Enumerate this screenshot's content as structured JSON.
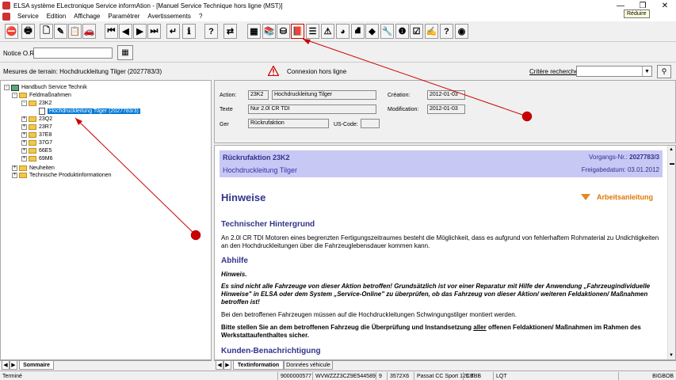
{
  "window": {
    "title": "ELSA système ELectronique Service informAtion - [Manuel Service Technique hors ligne (MST)]",
    "minimize_glyph": "—",
    "maximize_glyph": "❐",
    "close_glyph": "✕",
    "tooltip": "Réduire"
  },
  "menu": [
    "Service",
    "Edition",
    "Affichage",
    "Paramétrer",
    "Avertissements",
    "?"
  ],
  "toolbar": {
    "buttons": [
      {
        "name": "exit-icon",
        "glyph": "⛔"
      },
      {
        "name": "print-icon",
        "glyph": "🖶"
      },
      {
        "name": "new-doc-icon",
        "glyph": "🗋"
      },
      {
        "name": "edit-doc-icon",
        "glyph": "✎"
      },
      {
        "name": "clipboard-icon",
        "glyph": "📋"
      },
      {
        "name": "car-icon",
        "glyph": "🚗"
      },
      {
        "name": "first-icon",
        "glyph": "⏮"
      },
      {
        "name": "prev-icon",
        "glyph": "◀"
      },
      {
        "name": "next-icon",
        "glyph": "▶"
      },
      {
        "name": "last-icon",
        "glyph": "⏭"
      },
      {
        "name": "return-icon",
        "glyph": "↵"
      },
      {
        "name": "info-icon",
        "glyph": "ℹ"
      },
      {
        "name": "help-icon",
        "glyph": "?"
      },
      {
        "name": "swap-icon",
        "glyph": "⇄"
      },
      {
        "name": "calculator-icon",
        "glyph": "▦"
      },
      {
        "name": "book-stack-icon",
        "glyph": "📚"
      },
      {
        "name": "cylinder-icon",
        "glyph": "⛁"
      },
      {
        "name": "red-book-icon",
        "glyph": "📕"
      },
      {
        "name": "list-icon",
        "glyph": "☰"
      },
      {
        "name": "warning-icon",
        "glyph": "⚠"
      },
      {
        "name": "globe-icon",
        "glyph": "◕"
      },
      {
        "name": "bucket-icon",
        "glyph": "⛘"
      },
      {
        "name": "green-car-icon",
        "glyph": "◆"
      },
      {
        "name": "wrench-icon",
        "glyph": "🔧"
      },
      {
        "name": "service-icon",
        "glyph": "❶"
      },
      {
        "name": "checklist-icon",
        "glyph": "☑"
      },
      {
        "name": "notes-icon",
        "glyph": "✍"
      },
      {
        "name": "help-doc-icon",
        "glyph": "?"
      },
      {
        "name": "disc-icon",
        "glyph": "◉"
      }
    ]
  },
  "notice": {
    "label": "Notice O.R.:"
  },
  "status": {
    "mesures": "Mesures de terrain: Hochdruckleitung Tilger (2027783/3)",
    "connexion": "Connexion hors ligne",
    "critere": "Critère recherche"
  },
  "tree": {
    "root": "Handbuch Service Technik",
    "feld": "Feldmaßnahmen",
    "k2": "23K2",
    "selected": "Hochdruckleitung Tilger (2027783/3)",
    "children": [
      "23Q2",
      "23R7",
      "37E8",
      "37G7",
      "66E5",
      "69M6"
    ],
    "neuheiten": "Neuheiten",
    "technische": "Technische Produktinformationen",
    "toggle_minus": "-",
    "toggle_plus": "+"
  },
  "left_tabs": {
    "sommaire": "Sommaire"
  },
  "form": {
    "action_label": "Action:",
    "action_code": "23K2",
    "action_text": "Hochdruckleitung Tilger",
    "texte_label": "Texte",
    "texte_value": "Nur 2.0l CR TDI",
    "ger_label": "Ger",
    "ger_value": "Rückrufaktion",
    "uscode_label": "US-Code:",
    "creation_label": "Création:",
    "creation_value": "2012-01-03",
    "modification_label": "Modification:",
    "modification_value": "2012-01-03"
  },
  "content": {
    "header_code": "Rückrufaktion 23K2",
    "header_sub": "Hochdruckleitung Tilger",
    "vorgang_label": "Vorgangs-Nr.:",
    "vorgang_value": "2027783/3",
    "freigabe": "Freigabedatum: 03.01.2012",
    "hinweise": "Hinweise",
    "arbeitsanleitung": "Arbeitsanleitung",
    "sec1": "Technischer Hintergrund",
    "p1": "An 2.0l CR TDI Motoren eines begrenzten Fertigungszeitraumes besteht die Möglichkeit, dass es aufgrund von fehlerhaftem Rohmaterial zu Undichtigkeiten an den Hochdruckleitungen über die Fahrzeuglebensdauer kommen kann.",
    "sec2": "Abhilfe",
    "p2": "Hinweis.",
    "p3": "Es sind nicht alle Fahrzeuge von dieser Aktion betroffen! Grundsätzlich ist vor einer Reparatur mit Hilfe der Anwendung „Fahrzeugindividuelle Hinweise\" in ELSA oder dem System „Service-Online\" zu überprüfen, ob das Fahrzeug von dieser Aktion/ weiteren Feldaktionen/ Maßnahmen betroffen ist!",
    "p4": "Bei den betroffenen Fahrzeugen müssen auf die Hochdruckleitungen Schwingungstilger montiert werden.",
    "p5a": "Bitte stellen Sie an dem betroffenen Fahrzeug die Überprüfung und Instandsetzung ",
    "p5b": "aller",
    "p5c": " offenen Feldaktionen/ Maßnahmen im Rahmen des Werkstattaufenthaltes sicher.",
    "sec3": "Kunden-Benachrichtigung"
  },
  "right_tabs": {
    "textinformation": "Textinformation",
    "donnees": "Données véhicule"
  },
  "statusbar": {
    "termine": "Terminé",
    "cells": [
      "9000000577",
      "WVWZZZ3CZ9E544589",
      "9",
      "3572X6",
      "Passat CC Sport 125 T",
      "CBBB",
      "LQT"
    ],
    "bigbob": "BIGBOB"
  },
  "annotations": {
    "marker_a": "①",
    "marker_b": "①"
  },
  "colors": {
    "accent": "#33338c",
    "header_bg": "#c8c8f5",
    "orange": "#e07800",
    "selection": "#0078d7",
    "annotation": "#cc0000"
  }
}
